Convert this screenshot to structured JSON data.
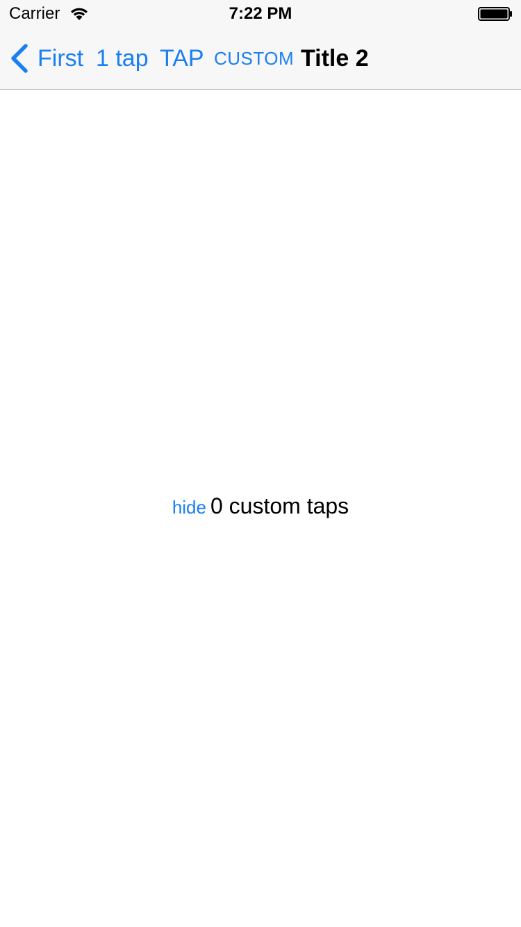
{
  "status_bar": {
    "carrier": "Carrier",
    "time": "7:22 PM",
    "wifi_icon": "wifi-icon",
    "battery_icon": "battery-icon"
  },
  "nav_bar": {
    "back_label": "First",
    "back_icon": "chevron-left-icon",
    "items": [
      {
        "label": "1 tap"
      },
      {
        "label": "TAP"
      },
      {
        "label": "CUSTOM"
      }
    ],
    "title": "Title 2",
    "accent_color": "#1a7ff0"
  },
  "content": {
    "hide_label": "hide",
    "taps_text": "0 custom taps"
  }
}
